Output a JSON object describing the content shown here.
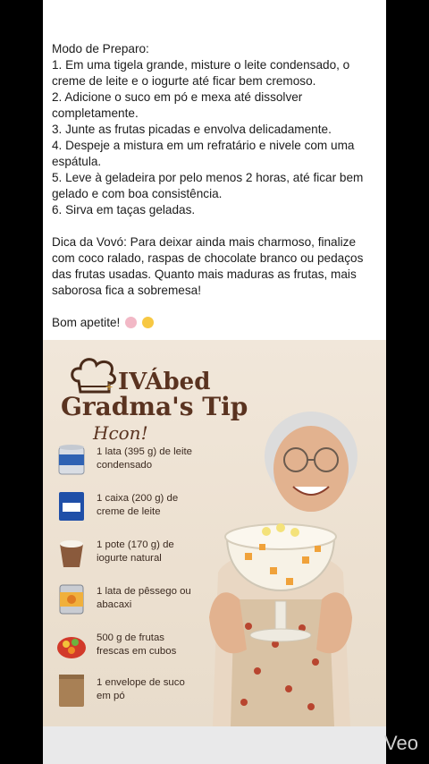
{
  "post": {
    "heading": "Modo de Preparo:",
    "steps": [
      "1. Em uma tigela grande, misture o leite condensado, o creme de leite e o iogurte até ficar bem cremoso.",
      "2. Adicione o suco em pó e mexa até dissolver completamente.",
      "3. Junte as frutas picadas e envolva delicadamente.",
      "4. Despeje a mistura em um refratário e nivele com uma espátula.",
      "5. Leve à geladeira por pelo menos 2 horas, até ficar bem gelado e com boa consistência.",
      "6. Sirva em taças geladas."
    ],
    "tip": "Dica da Vovó: Para deixar ainda mais charmoso, finalize com coco ralado, raspas de chocolate branco ou pedaços das frutas usadas. Quanto mais maduras as frutas, mais saborosa fica a sobremesa!",
    "closing": "Bom apetite!"
  },
  "card": {
    "title_line1": "IVÁbed",
    "title_line2": "Gradma's Tip",
    "title_line3": "Hcon!",
    "ingredients": [
      {
        "text": "1 lata (395 g) de leite condensado",
        "icon": "condensed-milk-can-icon"
      },
      {
        "text": "1 caixa (200 g) de creme de leite",
        "icon": "cream-box-icon"
      },
      {
        "text": "1 pote (170 g) de iogurte natural",
        "icon": "yogurt-pot-icon"
      },
      {
        "text": "1 lata de pêssego ou abacaxi",
        "icon": "fruit-can-icon"
      },
      {
        "text": "500 g de frutas frescas em cubos",
        "icon": "fruit-bowl-icon"
      },
      {
        "text": "1 envelope de suco em pó",
        "icon": "juice-sachet-icon"
      }
    ]
  },
  "watermark": "Veo"
}
